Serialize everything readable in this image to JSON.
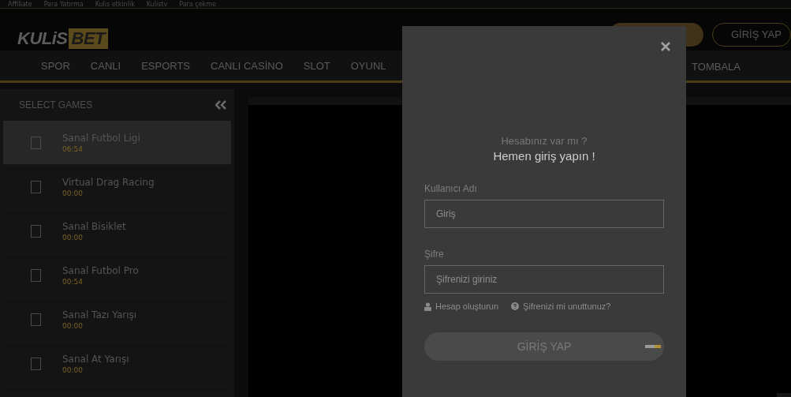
{
  "top_links": [
    "Affiliate",
    "Para Yatırma",
    "Kulis etkinlik",
    "Kulistv",
    "Para çekme"
  ],
  "logo": {
    "part_1": "KULiS",
    "part_2": "BET"
  },
  "header_buttons": [
    {
      "kind": "gold"
    },
    {
      "kind": "outline",
      "label": "GİRİŞ YAP"
    }
  ],
  "nav": {
    "left": [
      "SPOR",
      "CANLI",
      "ESPORTS",
      "CANLI CASİNO",
      "SLOT",
      "OYUNL"
    ],
    "right": [
      "TOMBALA"
    ]
  },
  "sidebar": {
    "title": "SELECT GAMES",
    "items": [
      {
        "name": "Sanal Futbol Ligi",
        "time": "06:54",
        "selected": true,
        "checked": false
      },
      {
        "name": "Virtual Drag Racing",
        "time": "00:00",
        "selected": false,
        "checked": false
      },
      {
        "name": "Sanal Bisiklet",
        "time": "00:00",
        "selected": false,
        "checked": false
      },
      {
        "name": "Sanal Futbol Pro",
        "time": "00:54",
        "selected": false,
        "checked": false
      },
      {
        "name": "Sanal Tazı Yarışı",
        "time": "00:00",
        "selected": false,
        "checked": false
      },
      {
        "name": "Sanal At Yarışı",
        "time": "00:00",
        "selected": false,
        "checked": false
      }
    ]
  },
  "modal": {
    "subtitle": "Hesabınız var mı ?",
    "title": "Hemen giriş yapın !",
    "fields": [
      {
        "label": "Kullanıcı Adı",
        "placeholder": "Giriş"
      },
      {
        "label": "Şifre",
        "placeholder": "Şifrenizi giriniz"
      }
    ],
    "links": [
      {
        "kind": "user",
        "label": "Hesap oluşturun"
      },
      {
        "kind": "help",
        "label": "Şifrenizi mi unuttunuz?"
      }
    ],
    "submit": "GİRİŞ YAP"
  }
}
